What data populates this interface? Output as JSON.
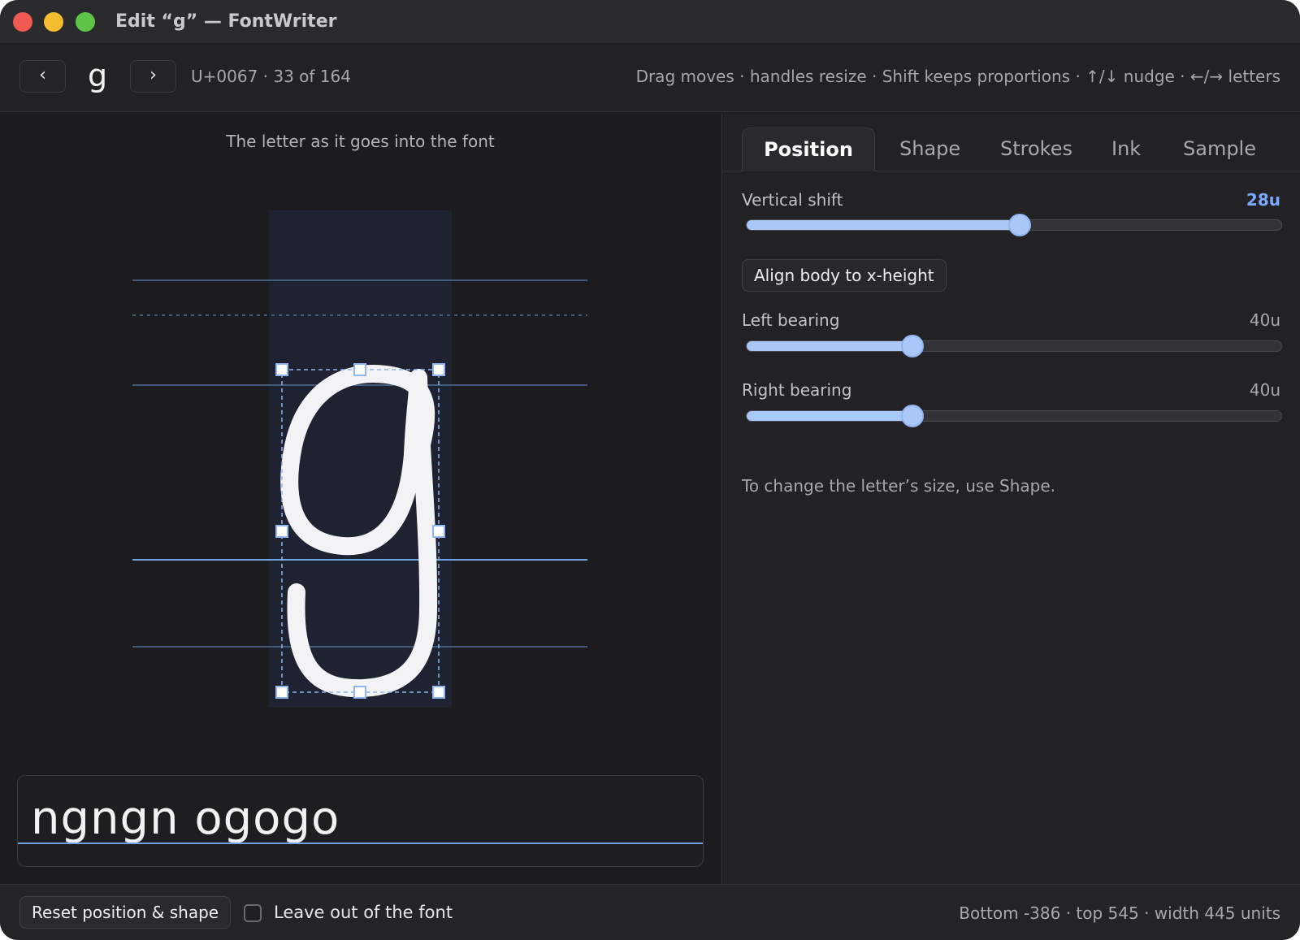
{
  "window": {
    "title": "Edit “g” — FontWriter"
  },
  "toolbar": {
    "prev_icon": "chevron-left-icon",
    "next_icon": "chevron-right-icon",
    "prev_glyph": "‹",
    "next_glyph": "›",
    "current_letter": "g",
    "codepoint_info": "U+0067 · 33 of 164",
    "hints": "Drag moves · handles resize · Shift keeps proportions · ↑/↓ nudge · ←/→ letters"
  },
  "canvas": {
    "caption": "The letter as it goes into the font"
  },
  "sample": {
    "text": "ngngn ogogo"
  },
  "tabs": [
    {
      "label": "Position",
      "active": true
    },
    {
      "label": "Shape",
      "active": false
    },
    {
      "label": "Strokes",
      "active": false
    },
    {
      "label": "Ink",
      "active": false
    },
    {
      "label": "Sample",
      "active": false
    }
  ],
  "position_panel": {
    "vertical_shift": {
      "label": "Vertical shift",
      "value_text": "28u",
      "fraction": 0.51
    },
    "align_button": "Align body to x-height",
    "left_bearing": {
      "label": "Left bearing",
      "value_text": "40u",
      "fraction": 0.31
    },
    "right_bearing": {
      "label": "Right bearing",
      "value_text": "40u",
      "fraction": 0.31
    },
    "size_note": "To change the letter’s size, use Shape."
  },
  "footer": {
    "reset_button": "Reset position & shape",
    "leave_out_label": "Leave out of the font",
    "leave_out_checked": false,
    "metrics": "Bottom -386 · top 545 · width 445 units"
  },
  "colors": {
    "accent": "#7aa7ff",
    "slider_fill": "#a9c8f7",
    "guide_line": "#4e6f96",
    "baseline": "#6fa2e0",
    "selection": "#8fb6f0"
  }
}
